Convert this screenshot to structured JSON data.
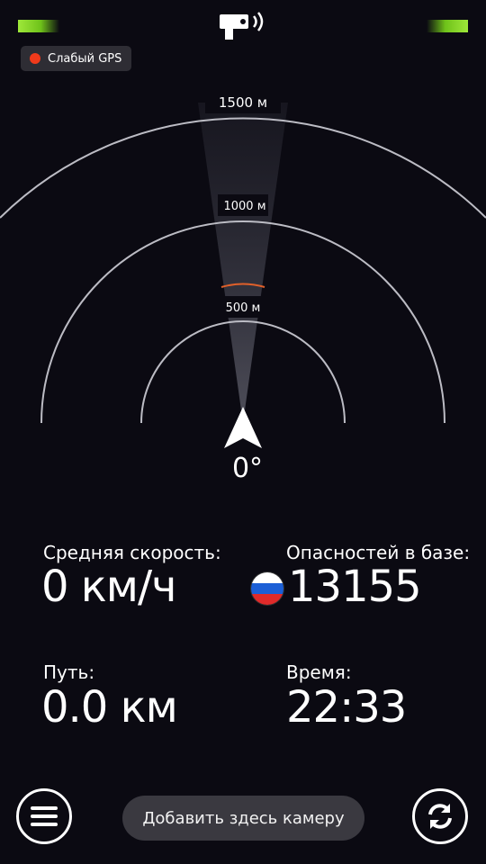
{
  "status": {
    "gps_label": "Слабый GPS",
    "gps_dot_color": "#f03a1b",
    "signal_bar_color": "#9fe83a",
    "top_icon": "speed-camera-icon"
  },
  "radar": {
    "rings": [
      "1500 м",
      "1000 м",
      "500 м"
    ],
    "direction_icon": "navigation-arrow-icon",
    "heading": "0°",
    "warning_arc_color": "#e0602a"
  },
  "stats": {
    "speed_label": "Средняя скорость:",
    "speed_value": "0 км/ч",
    "dangers_label": "Опасностей в базе:",
    "dangers_value": "13155",
    "flag_icon": "russia-flag-icon",
    "path_label": "Путь:",
    "path_value": "0.0 км",
    "time_label": "Время:",
    "time_value": "22:33"
  },
  "bottom_bar": {
    "menu_icon": "hamburger-menu-icon",
    "add_camera_label": "Добавить здесь камеру",
    "refresh_icon": "refresh-icon"
  }
}
